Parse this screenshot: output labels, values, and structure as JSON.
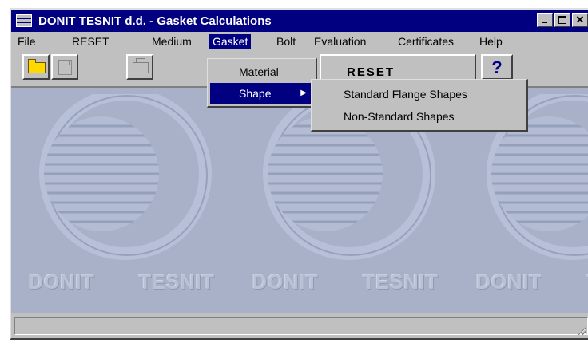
{
  "window": {
    "title": "DONIT TESNIT d.d. - Gasket Calculations"
  },
  "menubar": {
    "items": [
      "File",
      "RESET",
      "Medium",
      "Gasket",
      "Bolt",
      "Evaluation",
      "Certificates",
      "Help"
    ],
    "active": "Gasket"
  },
  "gasket_menu": {
    "items": [
      "Material",
      "Shape"
    ],
    "highlighted": "Shape"
  },
  "shape_submenu": {
    "items": [
      "Standard Flange Shapes",
      "Non-Standard Shapes"
    ]
  },
  "toolbar": {
    "reset_label": "RESET",
    "help_label": "?"
  },
  "background": {
    "watermark_words": [
      "DONIT",
      "TESNIT"
    ]
  },
  "statusbar": {
    "text": ""
  },
  "icons": {
    "open": "folder-icon",
    "save": "disk-icon",
    "print": "printer-icon",
    "submenu_arrow": "triangle-right-icon"
  },
  "colors": {
    "titlebar": "#000080",
    "face": "#c0c0c0",
    "client_background": "#a8b1c8",
    "highlight": "#000080"
  }
}
